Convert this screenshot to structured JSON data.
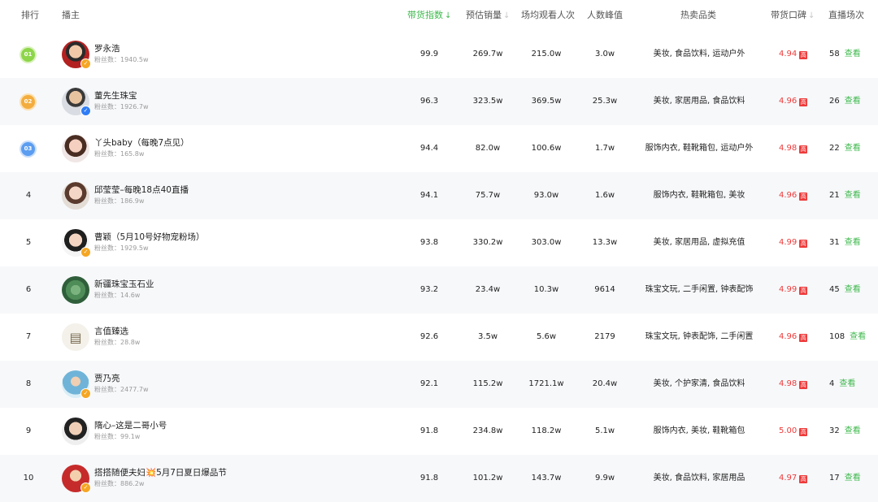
{
  "headers": {
    "rank": "排行",
    "anchor": "播主",
    "sales_index": "带货指数",
    "est_sales": "预估销量",
    "avg_viewers": "场均观看人次",
    "peak_viewers": "人数峰值",
    "hot_categories": "热卖品类",
    "reputation": "带货口碑",
    "live_sessions": "直播场次"
  },
  "sort_icons": {
    "sales_index": "↓",
    "est_sales": "↓",
    "reputation": "↓"
  },
  "colors": {
    "accent_green": "#3fb94e",
    "reputation_red": "#ee3b3b",
    "row_alt": "#f7f8fa"
  },
  "rows": [
    {
      "rank": "01",
      "name": "罗永浩",
      "fans": "粉丝数：1940.5w",
      "index": "99.9",
      "sales": "269.7w",
      "viewers": "215.0w",
      "peak": "3.0w",
      "categories": "美妆, 食品饮料, 运动户外",
      "rep": "4.94",
      "rep_badge": "高",
      "sessions": "58",
      "view": "查看"
    },
    {
      "rank": "02",
      "name": "董先生珠宝",
      "fans": "粉丝数：1926.7w",
      "index": "96.3",
      "sales": "323.5w",
      "viewers": "369.5w",
      "peak": "25.3w",
      "categories": "美妆, 家居用品, 食品饮料",
      "rep": "4.96",
      "rep_badge": "高",
      "sessions": "26",
      "view": "查看"
    },
    {
      "rank": "03",
      "name": "丫头baby（每晚7点见）",
      "fans": "粉丝数：165.8w",
      "index": "94.4",
      "sales": "82.0w",
      "viewers": "100.6w",
      "peak": "1.7w",
      "categories": "服饰内衣, 鞋靴箱包, 运动户外",
      "rep": "4.98",
      "rep_badge": "高",
      "sessions": "22",
      "view": "查看"
    },
    {
      "rank": "4",
      "name": "邱莹莹–每晚18点40直播",
      "fans": "粉丝数：186.9w",
      "index": "94.1",
      "sales": "75.7w",
      "viewers": "93.0w",
      "peak": "1.6w",
      "categories": "服饰内衣, 鞋靴箱包, 美妆",
      "rep": "4.96",
      "rep_badge": "高",
      "sessions": "21",
      "view": "查看"
    },
    {
      "rank": "5",
      "name": "曹颖（5月10号好物宠粉场）",
      "fans": "粉丝数：1929.5w",
      "index": "93.8",
      "sales": "330.2w",
      "viewers": "303.0w",
      "peak": "13.3w",
      "categories": "美妆, 家居用品, 虚拟充值",
      "rep": "4.99",
      "rep_badge": "高",
      "sessions": "31",
      "view": "查看"
    },
    {
      "rank": "6",
      "name": "新疆珠宝玉石业",
      "fans": "粉丝数：14.6w",
      "index": "93.2",
      "sales": "23.4w",
      "viewers": "10.3w",
      "peak": "9614",
      "categories": "珠宝文玩, 二手闲置, 钟表配饰",
      "rep": "4.99",
      "rep_badge": "高",
      "sessions": "45",
      "view": "查看"
    },
    {
      "rank": "7",
      "name": "言值臻选",
      "fans": "粉丝数：28.8w",
      "index": "92.6",
      "sales": "3.5w",
      "viewers": "5.6w",
      "peak": "2179",
      "categories": "珠宝文玩, 钟表配饰, 二手闲置",
      "rep": "4.96",
      "rep_badge": "高",
      "sessions": "108",
      "view": "查看"
    },
    {
      "rank": "8",
      "name": "贾乃亮",
      "fans": "粉丝数：2477.7w",
      "index": "92.1",
      "sales": "115.2w",
      "viewers": "1721.1w",
      "peak": "20.4w",
      "categories": "美妆, 个护家清, 食品饮料",
      "rep": "4.98",
      "rep_badge": "高",
      "sessions": "4",
      "view": "查看"
    },
    {
      "rank": "9",
      "name": "隋心–这是二哥小号",
      "fans": "粉丝数：99.1w",
      "index": "91.8",
      "sales": "234.8w",
      "viewers": "118.2w",
      "peak": "5.1w",
      "categories": "服饰内衣, 美妆, 鞋靴箱包",
      "rep": "5.00",
      "rep_badge": "高",
      "sessions": "32",
      "view": "查看"
    },
    {
      "rank": "10",
      "name": "搭搭随便夫妇💥5月7日夏日爆品节",
      "fans": "粉丝数：886.2w",
      "index": "91.8",
      "sales": "101.2w",
      "viewers": "143.7w",
      "peak": "9.9w",
      "categories": "美妆, 食品饮料, 家居用品",
      "rep": "4.97",
      "rep_badge": "高",
      "sessions": "17",
      "view": "查看"
    }
  ]
}
